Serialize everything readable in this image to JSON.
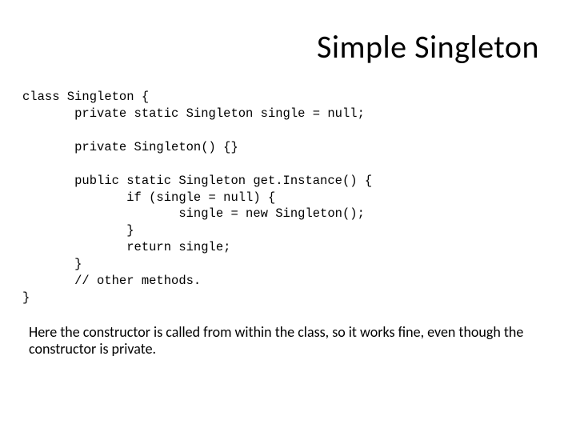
{
  "title": "Simple Singleton",
  "code": {
    "l01": "class Singleton {",
    "l02": "       private static Singleton single = null;",
    "l03": "",
    "l04": "       private Singleton() {}",
    "l05": "",
    "l06": "       public static Singleton get.Instance() {",
    "l07": "              if (single = null) {",
    "l08": "                     single = new Singleton();",
    "l09": "              }",
    "l10": "              return single;",
    "l11": "       }",
    "l12": "       // other methods.",
    "l13": "}"
  },
  "note": "Here the constructor is called from within the class, so it works fine, even though the constructor is private."
}
